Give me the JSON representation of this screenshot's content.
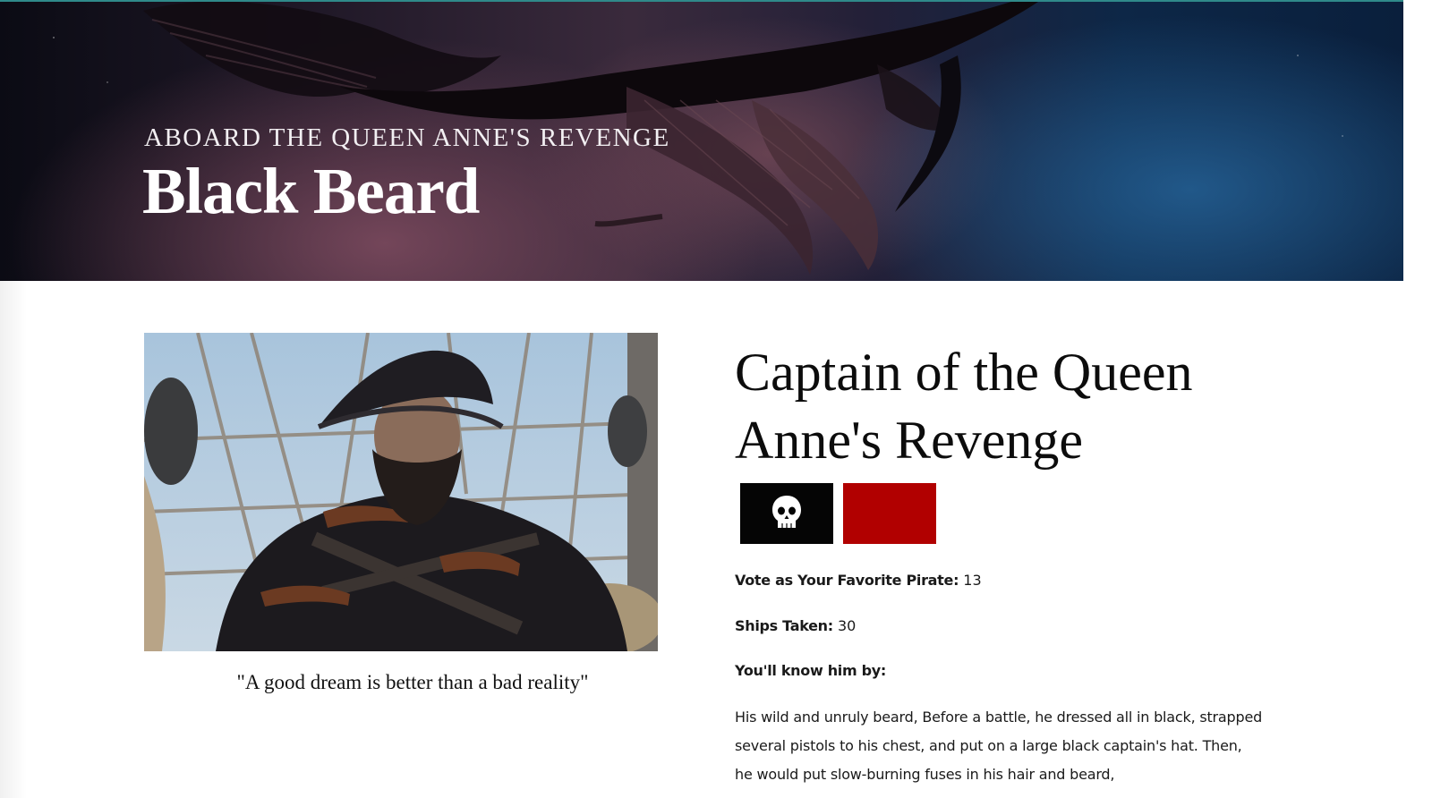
{
  "hero": {
    "subtitle": "ABOARD THE QUEEN ANNE'S REVENGE",
    "title": "Black Beard"
  },
  "portrait": {
    "quote": "\"A good dream is better than a bad reality\""
  },
  "details": {
    "heading": "Captain of the Queen Anne's Revenge",
    "flags": [
      {
        "icon": "skull-flag-icon",
        "color": "#050505"
      },
      {
        "icon": "red-flag-icon",
        "color": "#b10000"
      }
    ],
    "vote": {
      "label": "Vote as Your Favorite Pirate:",
      "value": "13"
    },
    "ships": {
      "label": "Ships Taken:",
      "value": "30"
    },
    "know": {
      "label": "You'll know him by:"
    },
    "description": "His wild and unruly beard, Before a battle, he dressed all in black, strapped several pistols to his chest, and put on a large black captain's hat. Then, he would put slow-burning fuses in his hair and beard,"
  }
}
